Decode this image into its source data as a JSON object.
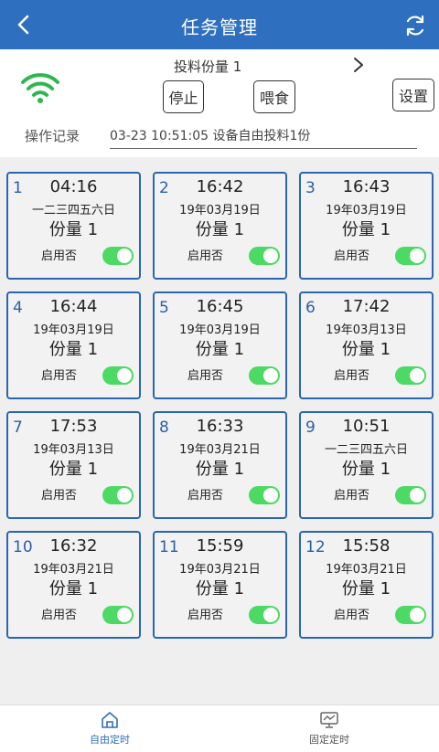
{
  "header": {
    "title": "任务管理"
  },
  "control": {
    "portion_label": "投料份量 1",
    "stop_label": "停止",
    "feed_label": "喂食",
    "settings_label": "设置",
    "log_label": "操作记录",
    "log_value": "03-23 10:51:05 设备自由投料1份"
  },
  "tasks": [
    {
      "index": "1",
      "time": "04:16",
      "date": "一二三四五六日",
      "portion": "份量 1",
      "enable_label": "启用否",
      "enabled": true
    },
    {
      "index": "2",
      "time": "16:42",
      "date": "19年03月19日",
      "portion": "份量 1",
      "enable_label": "启用否",
      "enabled": true
    },
    {
      "index": "3",
      "time": "16:43",
      "date": "19年03月19日",
      "portion": "份量 1",
      "enable_label": "启用否",
      "enabled": true
    },
    {
      "index": "4",
      "time": "16:44",
      "date": "19年03月19日",
      "portion": "份量 1",
      "enable_label": "启用否",
      "enabled": true
    },
    {
      "index": "5",
      "time": "16:45",
      "date": "19年03月19日",
      "portion": "份量 1",
      "enable_label": "启用否",
      "enabled": true
    },
    {
      "index": "6",
      "time": "17:42",
      "date": "19年03月13日",
      "portion": "份量 1",
      "enable_label": "启用否",
      "enabled": true
    },
    {
      "index": "7",
      "time": "17:53",
      "date": "19年03月13日",
      "portion": "份量 1",
      "enable_label": "启用否",
      "enabled": true
    },
    {
      "index": "8",
      "time": "16:33",
      "date": "19年03月21日",
      "portion": "份量 1",
      "enable_label": "启用否",
      "enabled": true
    },
    {
      "index": "9",
      "time": "10:51",
      "date": "一二三四五六日",
      "portion": "份量 1",
      "enable_label": "启用否",
      "enabled": true
    },
    {
      "index": "10",
      "time": "16:32",
      "date": "19年03月21日",
      "portion": "份量 1",
      "enable_label": "启用否",
      "enabled": true
    },
    {
      "index": "11",
      "time": "15:59",
      "date": "19年03月21日",
      "portion": "份量 1",
      "enable_label": "启用否",
      "enabled": true
    },
    {
      "index": "12",
      "time": "15:58",
      "date": "19年03月21日",
      "portion": "份量 1",
      "enable_label": "启用否",
      "enabled": true
    }
  ],
  "tabs": {
    "free_label": "自由定时",
    "fixed_label": "固定定时"
  },
  "colors": {
    "header_bg": "#2f6fbf",
    "card_border": "#2a66b0",
    "toggle_on": "#4cd964",
    "wifi": "#2db84d"
  }
}
